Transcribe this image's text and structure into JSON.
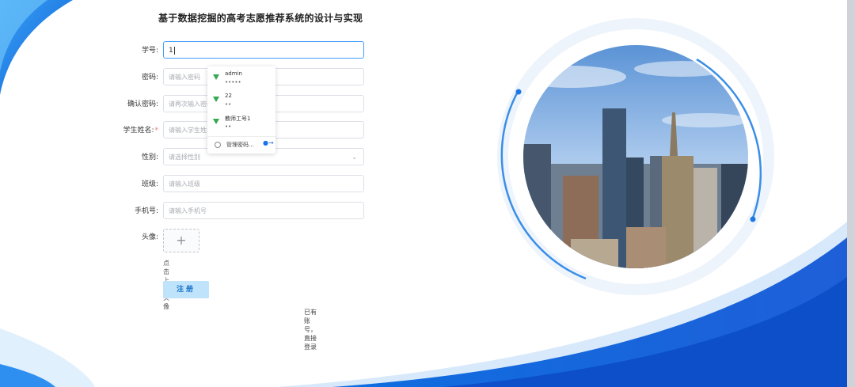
{
  "page": {
    "title": "基于数据挖掘的高考志愿推荐系统的设计与实现"
  },
  "form": {
    "student_id": {
      "label": "学号:",
      "value": "1"
    },
    "password": {
      "label": "密码:",
      "placeholder": "请输入密码"
    },
    "confirm_password": {
      "label": "确认密码:",
      "placeholder": "请再次输入密码"
    },
    "student_name": {
      "label": "学生姓名:",
      "required_mark": "*",
      "placeholder": "请输入学生姓名"
    },
    "gender": {
      "label": "性别:",
      "placeholder": "请选择性别"
    },
    "class": {
      "label": "班级:",
      "placeholder": "请输入班级"
    },
    "phone": {
      "label": "手机号:",
      "placeholder": "请输入手机号"
    },
    "avatar": {
      "label": "头像:",
      "upload_icon": "+",
      "hint": "点击上传头像"
    },
    "register_button": "注册",
    "login_link": "已有账号，直接登录"
  },
  "password_popup": {
    "items": [
      {
        "username": "admin",
        "masked": "•••••",
        "icon": "key-icon"
      },
      {
        "username": "22",
        "masked": "••",
        "icon": "key-icon"
      },
      {
        "username": "教师工号1",
        "masked": "••",
        "icon": "key-icon"
      }
    ],
    "manage_label": "管理密码...",
    "manage_icon": "chrome-icon"
  },
  "colors": {
    "accent": "#409eff",
    "primary_blue": "#1565d8",
    "button_bg": "#bfe3fb"
  }
}
